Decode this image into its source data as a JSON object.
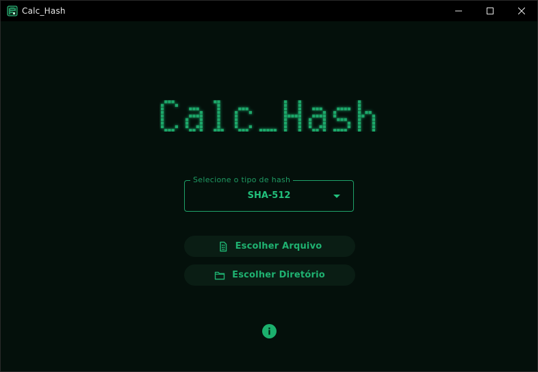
{
  "window": {
    "title": "Calc_Hash",
    "app_icon": "app-icon",
    "controls": [
      "minimize-icon",
      "maximize-icon",
      "close-icon"
    ]
  },
  "logo": {
    "text": "Calc_Hash",
    "style": "dot-matrix glowing green"
  },
  "hash_select": {
    "label": "Selecione o tipo de hash",
    "value": "SHA-512",
    "icon": "dropdown-arrow-icon"
  },
  "buttons": {
    "file": {
      "label": "Escolher Arquivo",
      "icon": "file-icon"
    },
    "dir": {
      "label": "Escolher Diretório",
      "icon": "folder-icon"
    }
  },
  "info": {
    "icon": "info-icon"
  },
  "colors": {
    "background": "#04100b",
    "accent": "#22c07c",
    "button_bg": "#0a1d14",
    "titlebar": "#000000"
  }
}
